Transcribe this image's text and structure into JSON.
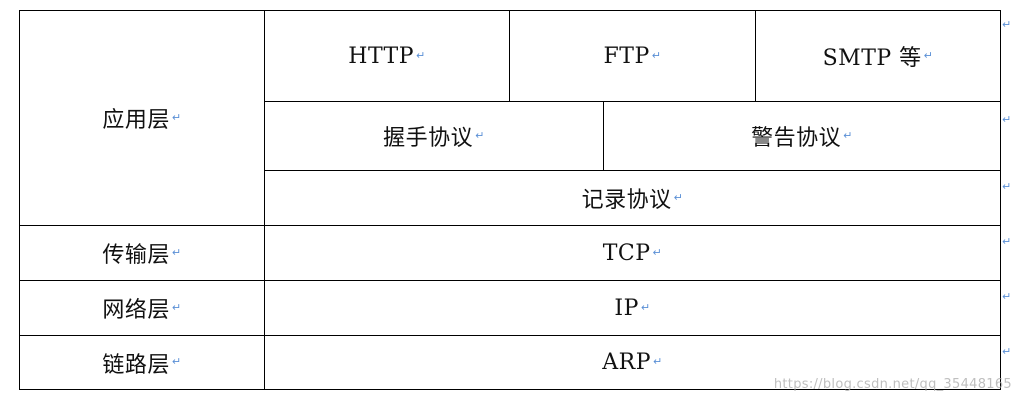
{
  "table": {
    "row_mark": "↵",
    "layers": {
      "application": "应用层",
      "transport": "传输层",
      "network": "网络层",
      "link": "链路层"
    },
    "protocols": {
      "http": "HTTP",
      "ftp": "FTP",
      "smtp": "SMTP 等",
      "handshake": "握手协议",
      "alert": "警告协议",
      "record": "记录协议",
      "tcp": "TCP",
      "ip": "IP",
      "arp": "ARP"
    }
  },
  "watermark": "https://blog.csdn.net/qq_35448165",
  "colors": {
    "border": "#000000",
    "paragraph_mark": "#5a8fd6",
    "watermark": "#aaaaaa"
  }
}
